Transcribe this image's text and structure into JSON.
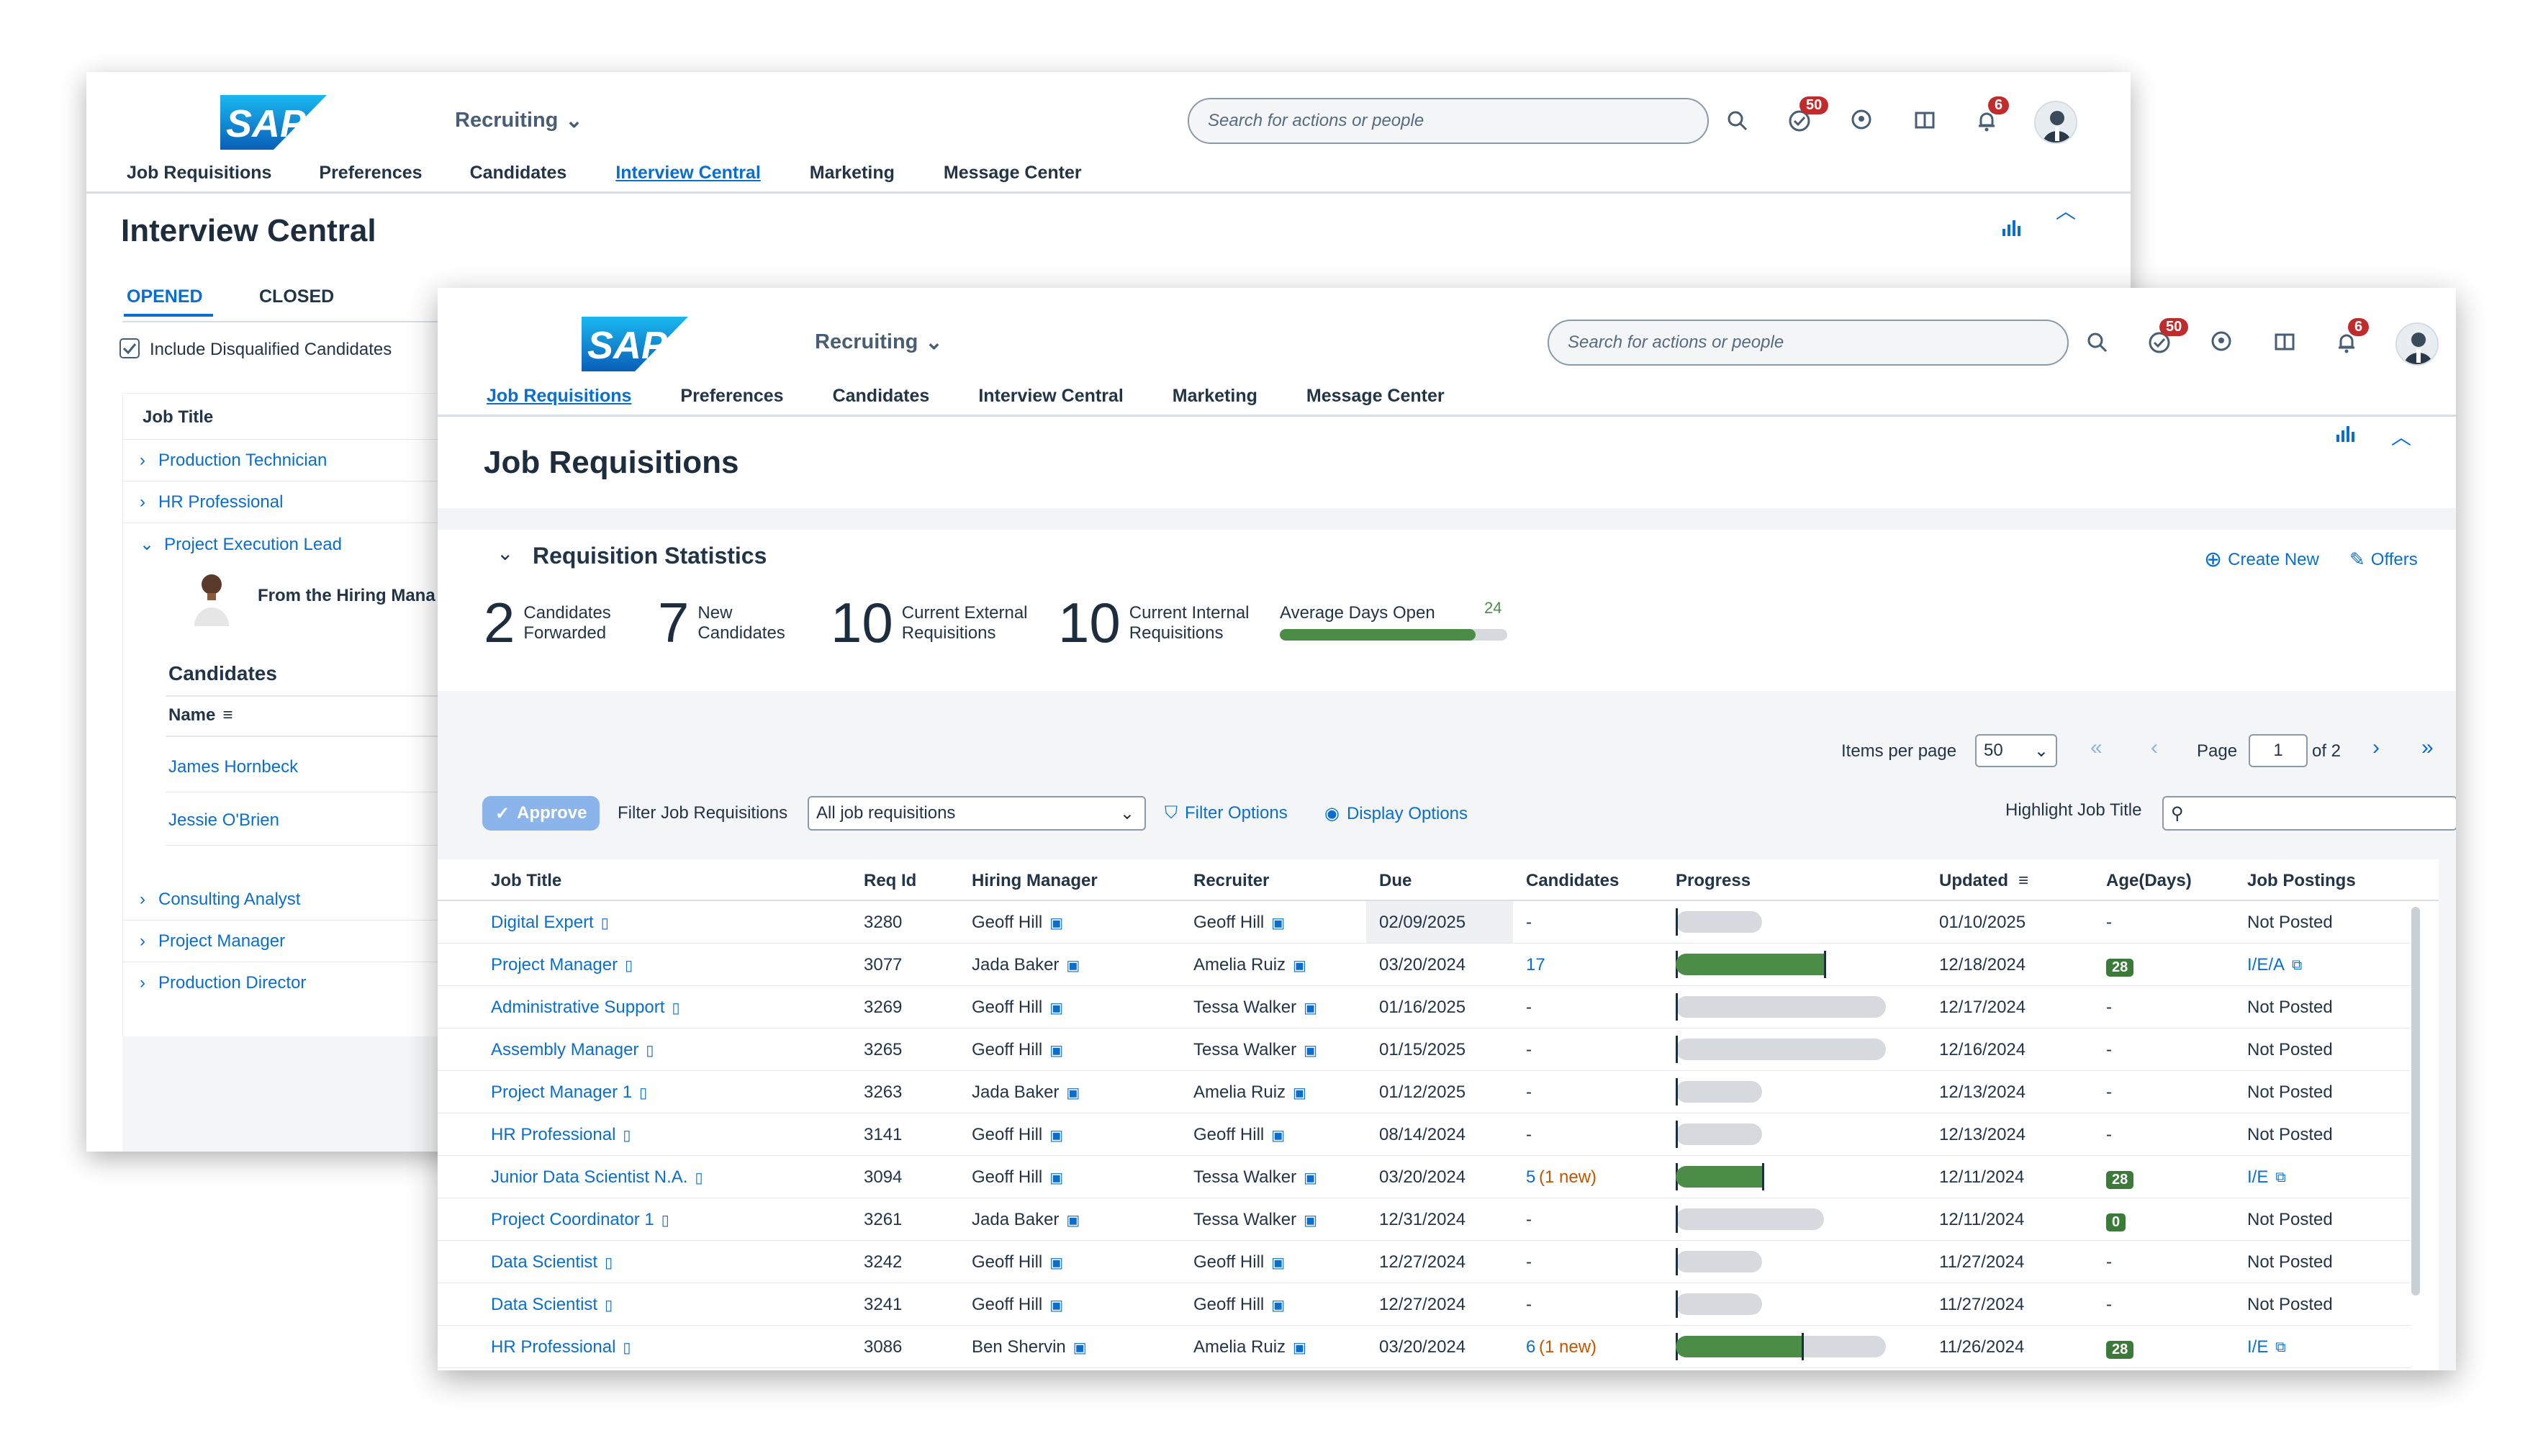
{
  "brand": {
    "logo_text": "SAP"
  },
  "header": {
    "menu_title": "Recruiting",
    "search_placeholder": "Search for actions or people",
    "todo_badge": "50",
    "notif_badge": "6"
  },
  "back_window": {
    "nav": [
      "Job Requisitions",
      "Preferences",
      "Candidates",
      "Interview Central",
      "Marketing",
      "Message Center"
    ],
    "active_nav": "Interview Central",
    "title": "Interview Central",
    "tabs": [
      "OPENED",
      "CLOSED"
    ],
    "checkbox_label": "Include Disqualified Candidates",
    "column_header": "Job Title",
    "jobs_top": [
      "Production Technician",
      "HR Professional",
      "Project Execution Lead"
    ],
    "hiring_manager_note": "From the Hiring Mana",
    "candidates_heading": "Candidates",
    "name_header": "Name",
    "candidates": [
      "James Hornbeck",
      "Jessie O'Brien"
    ],
    "jobs_bottom": [
      "Consulting Analyst",
      "Project Manager",
      "Production Director"
    ]
  },
  "front_window": {
    "nav": [
      "Job Requisitions",
      "Preferences",
      "Candidates",
      "Interview Central",
      "Marketing",
      "Message Center"
    ],
    "active_nav": "Job Requisitions",
    "title": "Job Requisitions",
    "stats_title": "Requisition Statistics",
    "create_new": "Create New",
    "offers": "Offers",
    "stats": [
      {
        "value": "2",
        "label1": "Candidates",
        "label2": "Forwarded"
      },
      {
        "value": "7",
        "label1": "New",
        "label2": "Candidates"
      },
      {
        "value": "10",
        "label1": "Current External",
        "label2": "Requisitions"
      },
      {
        "value": "10",
        "label1": "Current Internal",
        "label2": "Requisitions"
      }
    ],
    "avg_days_label": "Average Days Open",
    "avg_days_value": "24",
    "avg_days_fill": 0.86,
    "pagination": {
      "items_per_page_label": "Items per page",
      "items_per_page": "50",
      "page_label": "Page",
      "page": "1",
      "of_label": "of 2"
    },
    "toolbar": {
      "approve": "Approve",
      "filter_label": "Filter Job Requisitions",
      "filter_value": "All job requisitions",
      "filter_options": "Filter Options",
      "display_options": "Display Options",
      "highlight_label": "Highlight Job Title"
    },
    "columns": [
      "Job Title",
      "Req Id",
      "Hiring Manager",
      "Recruiter",
      "Due",
      "Candidates",
      "Progress",
      "Updated",
      "Age(Days)",
      "Job Postings"
    ],
    "rows": [
      {
        "title": "Digital Expert",
        "req": "3280",
        "hm": "Geoff Hill",
        "rec": "Geoff Hill",
        "due": "02/09/2025",
        "cand": "-",
        "cand_new": "",
        "progress": 0,
        "bar": "short",
        "updated": "01/10/2025",
        "age": "-",
        "posting": "Not Posted"
      },
      {
        "title": "Project Manager",
        "req": "3077",
        "hm": "Jada Baker",
        "rec": "Amelia Ruiz",
        "due": "03/20/2024",
        "cand": "17",
        "cand_new": "",
        "progress": 1,
        "bar": "medium",
        "updated": "12/18/2024",
        "age": "28",
        "posting": "I/E/A"
      },
      {
        "title": "Administrative Support",
        "req": "3269",
        "hm": "Geoff Hill",
        "rec": "Tessa Walker",
        "due": "01/16/2025",
        "cand": "-",
        "cand_new": "",
        "progress": 0,
        "bar": "long",
        "updated": "12/17/2024",
        "age": "-",
        "posting": "Not Posted"
      },
      {
        "title": "Assembly Manager",
        "req": "3265",
        "hm": "Geoff Hill",
        "rec": "Tessa Walker",
        "due": "01/15/2025",
        "cand": "-",
        "cand_new": "",
        "progress": 0,
        "bar": "long",
        "updated": "12/16/2024",
        "age": "-",
        "posting": "Not Posted"
      },
      {
        "title": "Project Manager 1",
        "req": "3263",
        "hm": "Jada Baker",
        "rec": "Amelia Ruiz",
        "due": "01/12/2025",
        "cand": "-",
        "cand_new": "",
        "progress": 0,
        "bar": "short",
        "updated": "12/13/2024",
        "age": "-",
        "posting": "Not Posted"
      },
      {
        "title": "HR Professional",
        "req": "3141",
        "hm": "Geoff Hill",
        "rec": "Geoff Hill",
        "due": "08/14/2024",
        "cand": "-",
        "cand_new": "",
        "progress": 0,
        "bar": "short",
        "updated": "12/13/2024",
        "age": "-",
        "posting": "Not Posted"
      },
      {
        "title": "Junior Data Scientist N.A.",
        "req": "3094",
        "hm": "Geoff Hill",
        "rec": "Tessa Walker",
        "due": "03/20/2024",
        "cand": "5",
        "cand_new": "(1 new)",
        "progress": 1,
        "bar": "short",
        "updated": "12/11/2024",
        "age": "28",
        "posting": "I/E"
      },
      {
        "title": "Project Coordinator 1",
        "req": "3261",
        "hm": "Jada Baker",
        "rec": "Tessa Walker",
        "due": "12/31/2024",
        "cand": "-",
        "cand_new": "",
        "progress": 0,
        "bar": "medium",
        "updated": "12/11/2024",
        "age": "0",
        "posting": "Not Posted"
      },
      {
        "title": "Data Scientist",
        "req": "3242",
        "hm": "Geoff Hill",
        "rec": "Geoff Hill",
        "due": "12/27/2024",
        "cand": "-",
        "cand_new": "",
        "progress": 0,
        "bar": "short",
        "updated": "11/27/2024",
        "age": "-",
        "posting": "Not Posted"
      },
      {
        "title": "Data Scientist",
        "req": "3241",
        "hm": "Geoff Hill",
        "rec": "Geoff Hill",
        "due": "12/27/2024",
        "cand": "-",
        "cand_new": "",
        "progress": 0,
        "bar": "short",
        "updated": "11/27/2024",
        "age": "-",
        "posting": "Not Posted"
      },
      {
        "title": "HR Professional",
        "req": "3086",
        "hm": "Ben Shervin",
        "rec": "Amelia Ruiz",
        "due": "03/20/2024",
        "cand": "6",
        "cand_new": "(1 new)",
        "progress": 0.6,
        "bar": "long",
        "updated": "11/26/2024",
        "age": "28",
        "posting": "I/E"
      }
    ]
  },
  "colors": {
    "accent": "#0a6ed1",
    "badge_red": "#c02c2c",
    "progress_green": "#4b8c46",
    "age_green": "#3c7a3a",
    "new_orange": "#c35500"
  }
}
